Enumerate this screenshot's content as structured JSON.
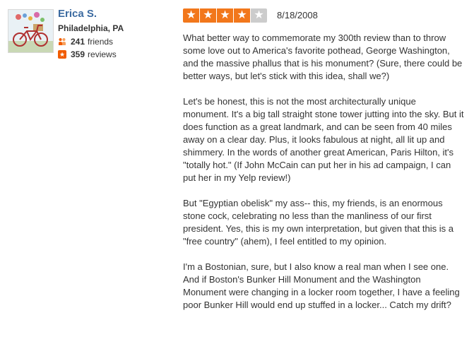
{
  "user": {
    "name": "Erica S.",
    "location": "Philadelphia, PA",
    "friends_count": "241",
    "friends_label": "friends",
    "reviews_count": "359",
    "reviews_label": "reviews",
    "avatar_icon": "bicycle-photo"
  },
  "review": {
    "rating": 4,
    "rating_max": 5,
    "star_color": "#f2771b",
    "star_empty_color": "#cccccc",
    "date": "8/18/2008",
    "paragraphs": [
      "What better way to commemorate my 300th review than to throw some love out to America's favorite pothead, George Washington, and the massive phallus that is his monument? (Sure, there could be better ways, but let's stick with this idea, shall we?)",
      "Let's be honest, this is not the most architecturally unique monument. It's a big tall straight stone tower jutting into the sky. But it does function as a great landmark, and can be seen from 40 miles away on a clear day. Plus, it looks fabulous at night, all lit up and shimmery. In the words of another great American, Paris Hilton, it's \"totally hot.\" (If John McCain can put her in his ad campaign, I can put her in my Yelp review!)",
      "But \"Egyptian obelisk\" my ass-- this, my friends, is an enormous stone cock, celebrating no less than the manliness of our first president. Yes, this is my own interpretation, but given that this is a \"free country\" (ahem), I feel entitled to my opinion.",
      "I'm a Bostonian, sure, but I also know a real man when I see one. And if Boston's Bunker Hill Monument and the Washington Monument were changing in a locker room together, I have a feeling poor Bunker Hill would end up stuffed in a locker... Catch my drift?"
    ]
  }
}
